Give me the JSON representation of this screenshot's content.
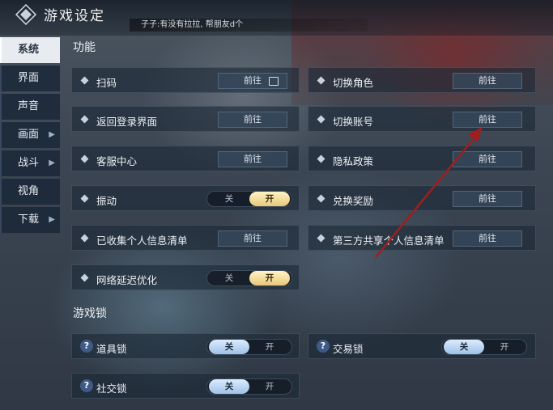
{
  "header": {
    "title": "游戏设定",
    "ticker": "子子:有没有拉拉, 帮朋友d个"
  },
  "sidebar": {
    "items": [
      {
        "label": "系统",
        "active": true,
        "chevron": false
      },
      {
        "label": "界面",
        "active": false,
        "chevron": false
      },
      {
        "label": "声音",
        "active": false,
        "chevron": false
      },
      {
        "label": "画面",
        "active": false,
        "chevron": true
      },
      {
        "label": "战斗",
        "active": false,
        "chevron": true
      },
      {
        "label": "视角",
        "active": false,
        "chevron": false
      },
      {
        "label": "下载",
        "active": false,
        "chevron": true
      }
    ]
  },
  "sections": {
    "function_title": "功能",
    "lock_title": "游戏锁"
  },
  "go_label": "前往",
  "toggle": {
    "off": "关",
    "on": "开"
  },
  "function_rows": {
    "scan": "扫码",
    "switch_role": "切换角色",
    "return_login": "返回登录界面",
    "switch_account": "切换账号",
    "customer_service": "客服中心",
    "privacy": "隐私政策",
    "vibration": "振动",
    "redeem": "兑换奖励",
    "personal_info": "已收集个人信息清单",
    "third_party": "第三方共享个人信息清单",
    "network_opt": "网络延迟优化"
  },
  "states": {
    "vibration": "on",
    "network_opt": "on",
    "item_lock": "off",
    "trade_lock": "off",
    "social_lock": "off"
  },
  "lock_rows": {
    "item_lock": "道具锁",
    "trade_lock": "交易锁",
    "social_lock": "社交锁"
  },
  "colors": {
    "gold_on": "#e8c878",
    "blue_selected": "#9fc1e6",
    "annotation_arrow": "#a01e1e"
  }
}
